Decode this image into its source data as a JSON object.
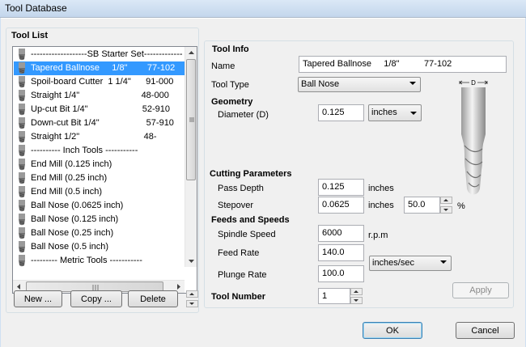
{
  "window": {
    "title": "Tool Database"
  },
  "tool_list": {
    "title": "Tool List",
    "items": [
      {
        "label": "-------------------SB Starter Set-------------",
        "selected": false
      },
      {
        "label": "Tapered Ballnose     1/8\"        77-102",
        "selected": true
      },
      {
        "label": "Spoil-board Cutter  1 1/4\"      91-000",
        "selected": false
      },
      {
        "label": "Straight 1/4\"                         48-000",
        "selected": false
      },
      {
        "label": "Up-cut Bit 1/4\"                      52-910",
        "selected": false
      },
      {
        "label": "Down-cut Bit 1/4\"                   57-910",
        "selected": false
      },
      {
        "label": "Straight 1/2\"                          48-",
        "selected": false
      },
      {
        "label": "---------- Inch Tools -----------",
        "selected": false
      },
      {
        "label": "End Mill (0.125 inch)",
        "selected": false
      },
      {
        "label": "End Mill (0.25 inch)",
        "selected": false
      },
      {
        "label": "End Mill (0.5 inch)",
        "selected": false
      },
      {
        "label": "Ball Nose (0.0625 inch)",
        "selected": false
      },
      {
        "label": "Ball Nose (0.125 inch)",
        "selected": false
      },
      {
        "label": "Ball Nose (0.25 inch)",
        "selected": false
      },
      {
        "label": "Ball Nose (0.5 inch)",
        "selected": false
      },
      {
        "label": "--------- Metric Tools -----------",
        "selected": false
      }
    ],
    "buttons": {
      "new": "New ...",
      "copy": "Copy ...",
      "delete": "Delete"
    }
  },
  "tool_info": {
    "title": "Tool Info",
    "name_label": "Name",
    "name_value": "Tapered Ballnose     1/8\"          77-102",
    "type_label": "Tool Type",
    "type_value": "Ball Nose",
    "diagram_label": "D"
  },
  "geometry": {
    "title": "Geometry",
    "diameter_label": "Diameter (D)",
    "diameter_value": "0.125",
    "units_value": "inches"
  },
  "cutting": {
    "title": "Cutting Parameters",
    "pass_depth_label": "Pass Depth",
    "pass_depth_value": "0.125",
    "pass_depth_unit": "inches",
    "stepover_label": "Stepover",
    "stepover_value": "0.0625",
    "stepover_unit": "inches",
    "stepover_percent": "50.0",
    "percent_sign": "%"
  },
  "feeds": {
    "title": "Feeds and Speeds",
    "spindle_label": "Spindle Speed",
    "spindle_value": "6000",
    "spindle_unit": "r.p.m",
    "feed_label": "Feed Rate",
    "feed_value": "140.0",
    "plunge_label": "Plunge Rate",
    "plunge_value": "100.0",
    "rate_units": "inches/sec"
  },
  "tool_number": {
    "label": "Tool Number",
    "value": "1"
  },
  "apply": "Apply",
  "ok": "OK",
  "cancel": "Cancel"
}
